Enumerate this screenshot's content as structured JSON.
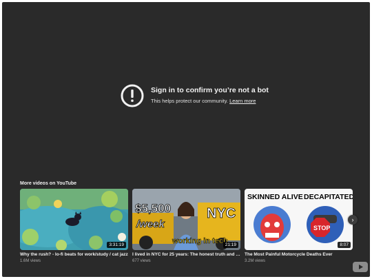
{
  "notice": {
    "title": "Sign in to confirm you’re not a bot",
    "subtitle": "This helps protect our community.",
    "link_label": "Learn more",
    "icon": "alert-circle-icon"
  },
  "more_videos": {
    "heading": "More videos on YouTube",
    "videos": [
      {
        "title": "Why the rush? - lo-fi beats for work/study / cat jazz",
        "views": "1.6M views",
        "duration": "3:31:19"
      },
      {
        "title": "I lived in NYC for 25 years: The honest truth and w...",
        "views": "677 views",
        "duration": "21:19",
        "thumb_text": [
          "$5,500",
          "/week",
          "NYC",
          "working in tech"
        ]
      },
      {
        "title": "The Most Painful Motorcycle Deaths Ever",
        "views": "3.2M views",
        "duration": "8:07",
        "thumb_text": [
          "SKINNED ALIVE",
          "DECAPITATED",
          "STOP"
        ]
      }
    ]
  },
  "controls": {
    "next_icon": "chevron-right-icon",
    "logo_icon": "youtube-logo-icon"
  }
}
